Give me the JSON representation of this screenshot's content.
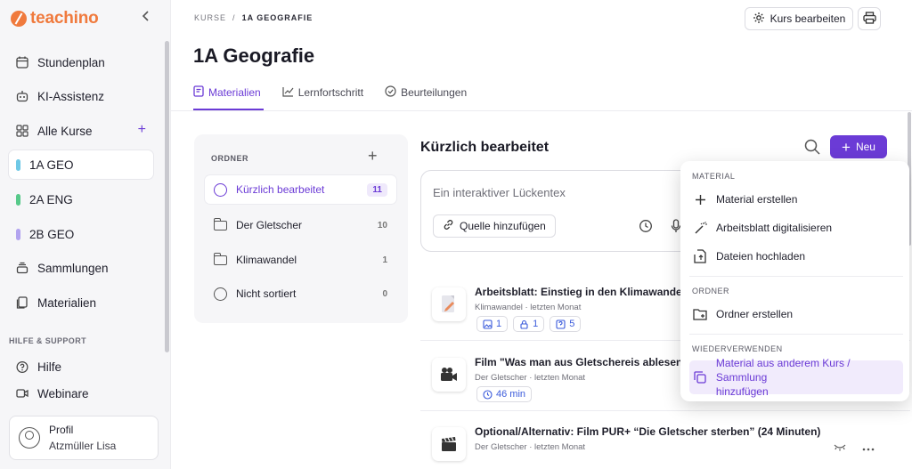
{
  "brand": {
    "name": "teachino"
  },
  "sidebar": {
    "items": [
      {
        "label": "Stundenplan"
      },
      {
        "label": "KI-Assistenz"
      },
      {
        "label": "Alle Kurse"
      },
      {
        "label": "1A GEO",
        "color": "#6ec8e6"
      },
      {
        "label": "2A ENG",
        "color": "#57c98a"
      },
      {
        "label": "2B GEO",
        "color": "#b2a3ef"
      },
      {
        "label": "Sammlungen"
      },
      {
        "label": "Materialien"
      },
      {
        "label": "Hilfe"
      },
      {
        "label": "Webinare"
      }
    ],
    "section_label": "HILFE & SUPPORT",
    "profile": {
      "title": "Profil",
      "name": "Atzmüller Lisa"
    }
  },
  "header": {
    "breadcrumb_root": "KURSE",
    "breadcrumb_sep": "/",
    "breadcrumb_current": "1A GEOGRAFIE",
    "title": "1A Geografie",
    "edit_label": "Kurs bearbeiten",
    "tabs": [
      {
        "label": "Materialien"
      },
      {
        "label": "Lernfortschritt"
      },
      {
        "label": "Beurteilungen"
      }
    ]
  },
  "folders": {
    "heading": "ORDNER",
    "rows": [
      {
        "label": "Kürzlich bearbeitet",
        "count": "11"
      },
      {
        "label": "Der Gletscher",
        "count": "10"
      },
      {
        "label": "Klimawandel",
        "count": "1"
      },
      {
        "label": "Nicht sortiert",
        "count": "0"
      }
    ]
  },
  "main": {
    "title": "Kürzlich bearbeitet",
    "new_label": "Neu",
    "ai_placeholder": "Ein interaktiver Lückentex",
    "source_label": "Quelle hinzufügen",
    "items": [
      {
        "title": "Arbeitsblatt: Einstieg in den Klimawandel",
        "meta": "Klimawandel · letzten Monat",
        "chips": [
          "1",
          "1",
          "5"
        ]
      },
      {
        "title": "Film \"Was man aus Gletschereis ablesen kann",
        "meta": "Der Gletscher · letzten Monat",
        "duration": "46 min"
      },
      {
        "title": "Optional/Alternativ: Film PUR+ “Die Gletscher sterben” (24 Minuten)",
        "meta": "Der Gletscher · letzten Monat"
      }
    ]
  },
  "dropdown": {
    "section_material": "MATERIAL",
    "create_material": "Material erstellen",
    "digitize": "Arbeitsblatt digitalisieren",
    "upload": "Dateien hochladen",
    "section_folder": "ORDNER",
    "create_folder": "Ordner erstellen",
    "section_reuse": "WIEDERVERWENDEN",
    "reuse_line1": "Material aus anderem Kurs / Sammlung",
    "reuse_line2": "hinzufügen"
  },
  "colors": {
    "accent": "#6b3bd6",
    "brand": "#f07a3d"
  }
}
